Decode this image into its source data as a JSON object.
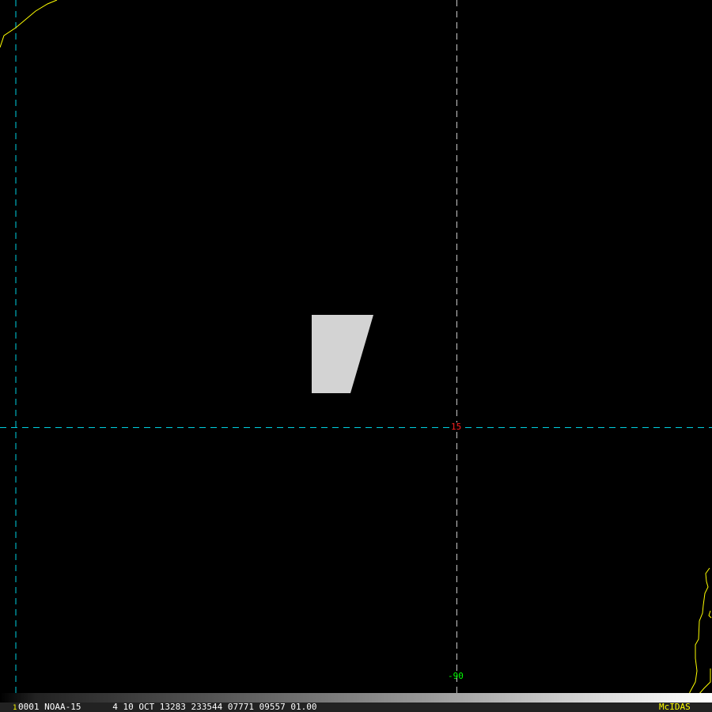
{
  "map": {
    "lat_label": "15",
    "lon_label": "-90",
    "colors": {
      "grid_lat": "#00d0e0",
      "grid_lon": "#c8c8c8",
      "coast": "#ffff00",
      "lat_label": "#ff2020",
      "lon_label": "#00ff00",
      "feature": "#d3d3d3"
    }
  },
  "info_bar": {
    "frame_number": "1",
    "text": "0001 NOAA-15      4 10 OCT 13283 233544 07771 09557 01.00",
    "brand": "McIDAS"
  }
}
